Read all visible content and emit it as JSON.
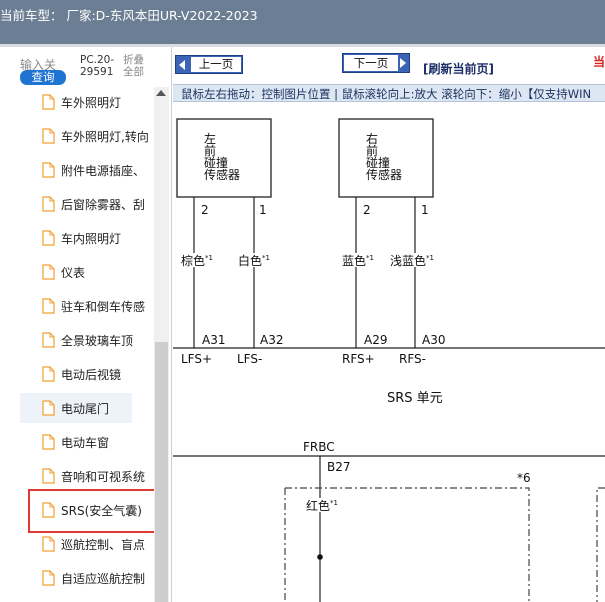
{
  "titlebar": {
    "title": "当前车型： 厂家:D-东风本田UR-V2022-2023"
  },
  "sidebar": {
    "search_label": "输入关",
    "search_button": "查询",
    "pc_code": "PC.20-29591",
    "collapse_all": "折叠全部",
    "items": [
      {
        "label": "车外照明灯"
      },
      {
        "label": "车外照明灯,转向"
      },
      {
        "label": "附件电源插座、"
      },
      {
        "label": "后窗除雾器、刮"
      },
      {
        "label": "车内照明灯"
      },
      {
        "label": "仪表"
      },
      {
        "label": "驻车和倒车传感"
      },
      {
        "label": "全景玻璃车顶"
      },
      {
        "label": "电动后视镜"
      },
      {
        "label": "电动尾门"
      },
      {
        "label": "电动车窗"
      },
      {
        "label": "音响和可视系统"
      },
      {
        "label": "SRS(安全气囊)"
      },
      {
        "label": "巡航控制、盲点"
      },
      {
        "label": "自适应巡航控制"
      }
    ]
  },
  "toolbar": {
    "prev_page": "上一页",
    "next_page": "下一页",
    "refresh": "[刷新当前页]",
    "overflow_text": "当"
  },
  "hint_bar": {
    "text": "鼠标左右拖动：控制图片位置 | 鼠标滚轮向上:放大  滚轮向下：缩小【仅支持WIN"
  },
  "diagram": {
    "left_sensor": {
      "lines": [
        "左",
        "前",
        "碰撞",
        "传感器"
      ]
    },
    "right_sensor": {
      "lines": [
        "右",
        "前",
        "碰撞",
        "传感器"
      ]
    },
    "pins": [
      "2",
      "1",
      "2",
      "1"
    ],
    "wire_colors": [
      "棕色",
      "白色",
      "蓝色",
      "浅蓝色"
    ],
    "footnote_mark": "*1",
    "connectors": [
      "A31",
      "A32",
      "A29",
      "A30"
    ],
    "terminals": [
      "LFS+",
      "LFS-",
      "RFS+",
      "RFS-"
    ],
    "unit_label": "SRS 单元",
    "frbc_label": "FRBC",
    "b27_label": "B27",
    "note_mark": "*6",
    "red_wire": "红色"
  },
  "colors": {
    "titlebar_bg": "#6c7e93",
    "search_button": "#1f74d1",
    "nav_button": "#3b64b5",
    "refresh_text": "#1c2e66",
    "hint_bar_bg": "#dde7f4",
    "highlight_box": "#e03a36",
    "doc_icon": "#f0a030"
  }
}
